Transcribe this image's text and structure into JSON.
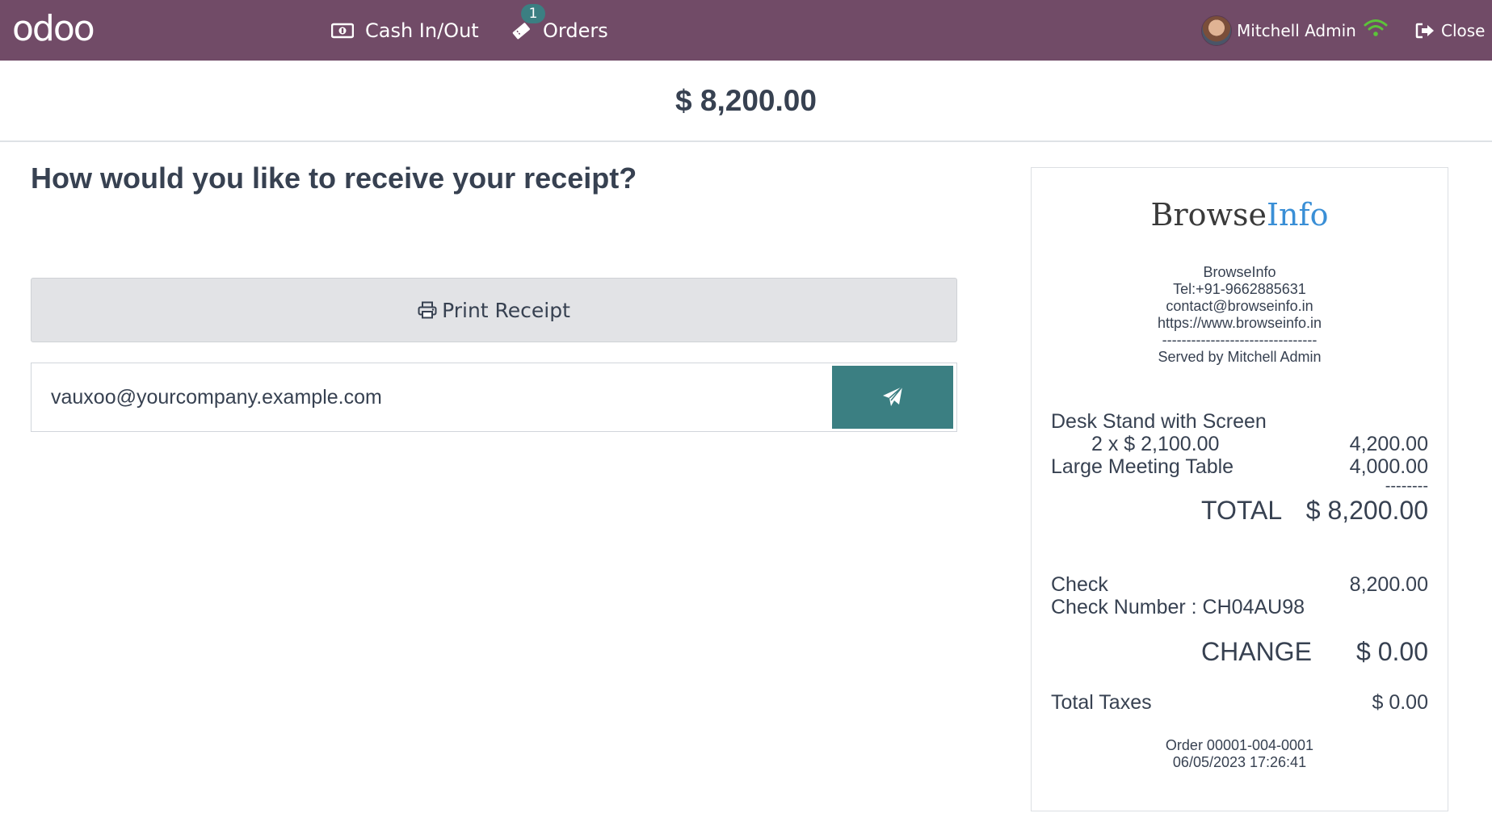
{
  "navbar": {
    "logo": "odoo",
    "cash_in_out": "Cash In/Out",
    "orders": "Orders",
    "orders_badge": "1",
    "user_name": "Mitchell Admin",
    "close": "Close",
    "bg_color": "#714B67"
  },
  "amount_due": "$ 8,200.00",
  "receipt_screen": {
    "question": "How would you like to receive your receipt?",
    "print_label": "Print Receipt",
    "email_value": "vauxoo@yourcompany.example.com",
    "send_color": "#3B7F82"
  },
  "receipt": {
    "brand_part1": "Browse",
    "brand_part2": "Info",
    "company": "BrowseInfo",
    "tel": "Tel:+91-9662885631",
    "email": "contact@browseinfo.in",
    "website": "https://www.browseinfo.in",
    "divider": "--------------------------------",
    "served_by": "Served by Mitchell Admin",
    "lines": [
      {
        "product": "Desk Stand with Screen",
        "detail": "2 x $ 2,100.00",
        "amount": "4,200.00"
      },
      {
        "product": "Large Meeting Table",
        "detail": "",
        "amount": "4,000.00"
      }
    ],
    "total_divider": "--------",
    "total_label": "TOTAL",
    "total_amount": "$ 8,200.00",
    "payment_method": "Check",
    "payment_amount": "8,200.00",
    "check_number": "Check Number : CH04AU98",
    "change_label": "CHANGE",
    "change_amount": "$ 0.00",
    "taxes_label": "Total Taxes",
    "taxes_amount": "$ 0.00",
    "order_ref": "Order 00001-004-0001",
    "order_datetime": "06/05/2023 17:26:41"
  }
}
